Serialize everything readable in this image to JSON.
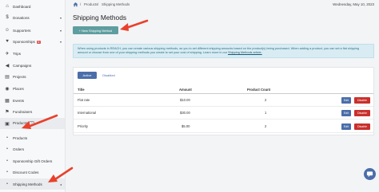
{
  "sidebar": {
    "items": [
      {
        "label": "Dashboard",
        "icon": "home-icon",
        "glyph": "⌂"
      },
      {
        "label": "Donations",
        "icon": "dollar-icon",
        "glyph": "$",
        "caret": "▾"
      },
      {
        "label": "Supporters",
        "icon": "user-icon",
        "glyph": "☺",
        "caret": "▾"
      },
      {
        "label": "Sponsorships",
        "icon": "handshake-icon",
        "glyph": "♥",
        "badge": "6",
        "caret": "▾"
      },
      {
        "label": "Trips",
        "icon": "plane-icon",
        "glyph": "✈"
      },
      {
        "label": "Campaigns",
        "icon": "megaphone-icon",
        "glyph": "◀"
      },
      {
        "label": "Projects",
        "icon": "clipboard-icon",
        "glyph": "▤"
      },
      {
        "label": "Places",
        "icon": "map-pin-icon",
        "glyph": "◉"
      },
      {
        "label": "Events",
        "icon": "calendar-icon",
        "glyph": "▦"
      },
      {
        "label": "Fundraisers",
        "icon": "fundraiser-icon",
        "glyph": "⚑"
      },
      {
        "label": "Products",
        "icon": "box-icon",
        "glyph": "▣",
        "help": "?"
      }
    ],
    "subitems": [
      {
        "label": "Products"
      },
      {
        "label": "Orders"
      },
      {
        "label": "Sponsorship Gift Orders"
      },
      {
        "label": "Discount Codes"
      },
      {
        "label": "Shipping Methods",
        "caret": "◂"
      }
    ]
  },
  "topbar": {
    "breadcrumb": [
      "Products",
      "Shipping Methods"
    ],
    "separator": "/",
    "date": "Wednesday, May 10, 2023"
  },
  "page": {
    "title": "Shipping Methods",
    "new_button": "+ New Shipping Method",
    "info_text": "When using products in REACH, you can create various shipping methods, as you to set different shipping amounts based on the product(s) being purchased. When adding a product, you can set a flat shipping amount or choose from one of your shipping methods you create to set your cost of shipping. Learn more in our ",
    "info_link": "Shipping Methods article."
  },
  "tabs": {
    "active": "Active",
    "disabled": "Disabled"
  },
  "table": {
    "headers": {
      "title": "Title",
      "amount": "Amount",
      "count": "Product Count"
    },
    "rows": [
      {
        "title": "Flat rate",
        "amount": "$10.00",
        "count": "2"
      },
      {
        "title": "International",
        "amount": "$30.00",
        "count": "1"
      },
      {
        "title": "Priority",
        "amount": "$5.00",
        "count": "2"
      }
    ],
    "edit_label": "Edit",
    "disable_label": "Disable"
  },
  "colors": {
    "accent": "#4b6ea9",
    "new_button": "#5f9ea0",
    "danger": "#c9302c",
    "annotation_arrow": "#e8412c"
  }
}
